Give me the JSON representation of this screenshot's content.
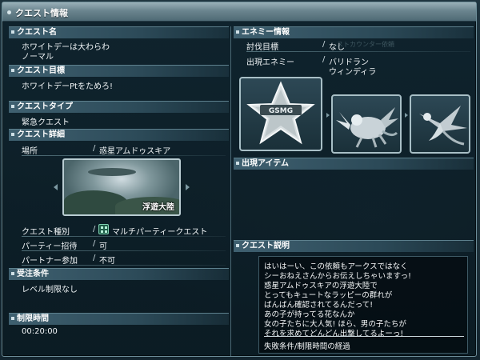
{
  "window": {
    "title": "クエスト情報"
  },
  "quest_name": {
    "header": "クエスト名",
    "lines": [
      "ホワイトデーは大わらわ",
      "ノーマル"
    ]
  },
  "quest_goal": {
    "header": "クエスト目標",
    "text": "ホワイトデーPtをためろ!"
  },
  "quest_type": {
    "header": "クエストタイプ",
    "text": "緊急クエスト"
  },
  "quest_details": {
    "header": "クエスト詳細",
    "location_label": "場所",
    "location_value": "惑星アムドゥスキア",
    "location_caption": "浮遊大陸",
    "rows": [
      {
        "label": "クエスト種別",
        "value": "マルチパーティークエスト"
      },
      {
        "label": "パーティー招待",
        "value": "可"
      },
      {
        "label": "パートナー参加",
        "value": "不可"
      }
    ]
  },
  "requirements": {
    "header": "受注条件",
    "text": "レベル制限なし"
  },
  "time_limit": {
    "header": "制限時間",
    "text": "00:20:00"
  },
  "enemy_info": {
    "header": "エネミー情報",
    "target_label": "討伐目標",
    "target_value": "なし",
    "enemies_label": "出現エネミー",
    "enemies": [
      "バリドラン",
      "ウィンディラ"
    ],
    "ghost_text": "ストカウンター依頼"
  },
  "items": {
    "header": "出現アイテム"
  },
  "description": {
    "header": "クエスト説明",
    "lines": [
      "はいはーい、この依頼もアークスではなく",
      "シーおねえさんからお伝えしちゃいますっ!",
      "惑星アムドゥスキアの浮遊大陸で",
      "とってもキュートなラッピーの群れが",
      "ばんばん確認されてるんだって!",
      "あの子が持ってる花なんか",
      "女の子たちに大人気! ほら、男の子たちが",
      "それを求めてどんどん出撃してるよーっ!"
    ],
    "fail_condition": "失敗条件/制限時間の経過"
  },
  "colors": {
    "panel_bg": "#0e222c",
    "header_bg": "#3f6070",
    "titlebar": "#6b858f",
    "accent_multi": "#1f5c48"
  }
}
